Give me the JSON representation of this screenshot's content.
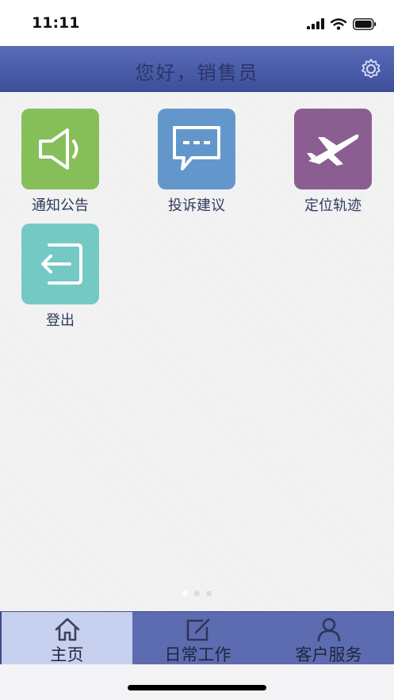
{
  "status_bar": {
    "time": "11:11"
  },
  "header": {
    "title": "您好，销售员"
  },
  "tiles": [
    {
      "label": "通知公告",
      "color": "#86bf59"
    },
    {
      "label": "投诉建议",
      "color": "#6397cc"
    },
    {
      "label": "定位轨迹",
      "color": "#8b5e91"
    },
    {
      "label": "登出",
      "color": "#74c9c5"
    }
  ],
  "tabs": [
    {
      "label": "主页",
      "active": true
    },
    {
      "label": "日常工作",
      "active": false
    },
    {
      "label": "客户服务",
      "active": false
    }
  ],
  "colors": {
    "header": "#4a5aa8",
    "tabbar": "#5d6bb0",
    "tab_active": "#c7d1ef"
  }
}
